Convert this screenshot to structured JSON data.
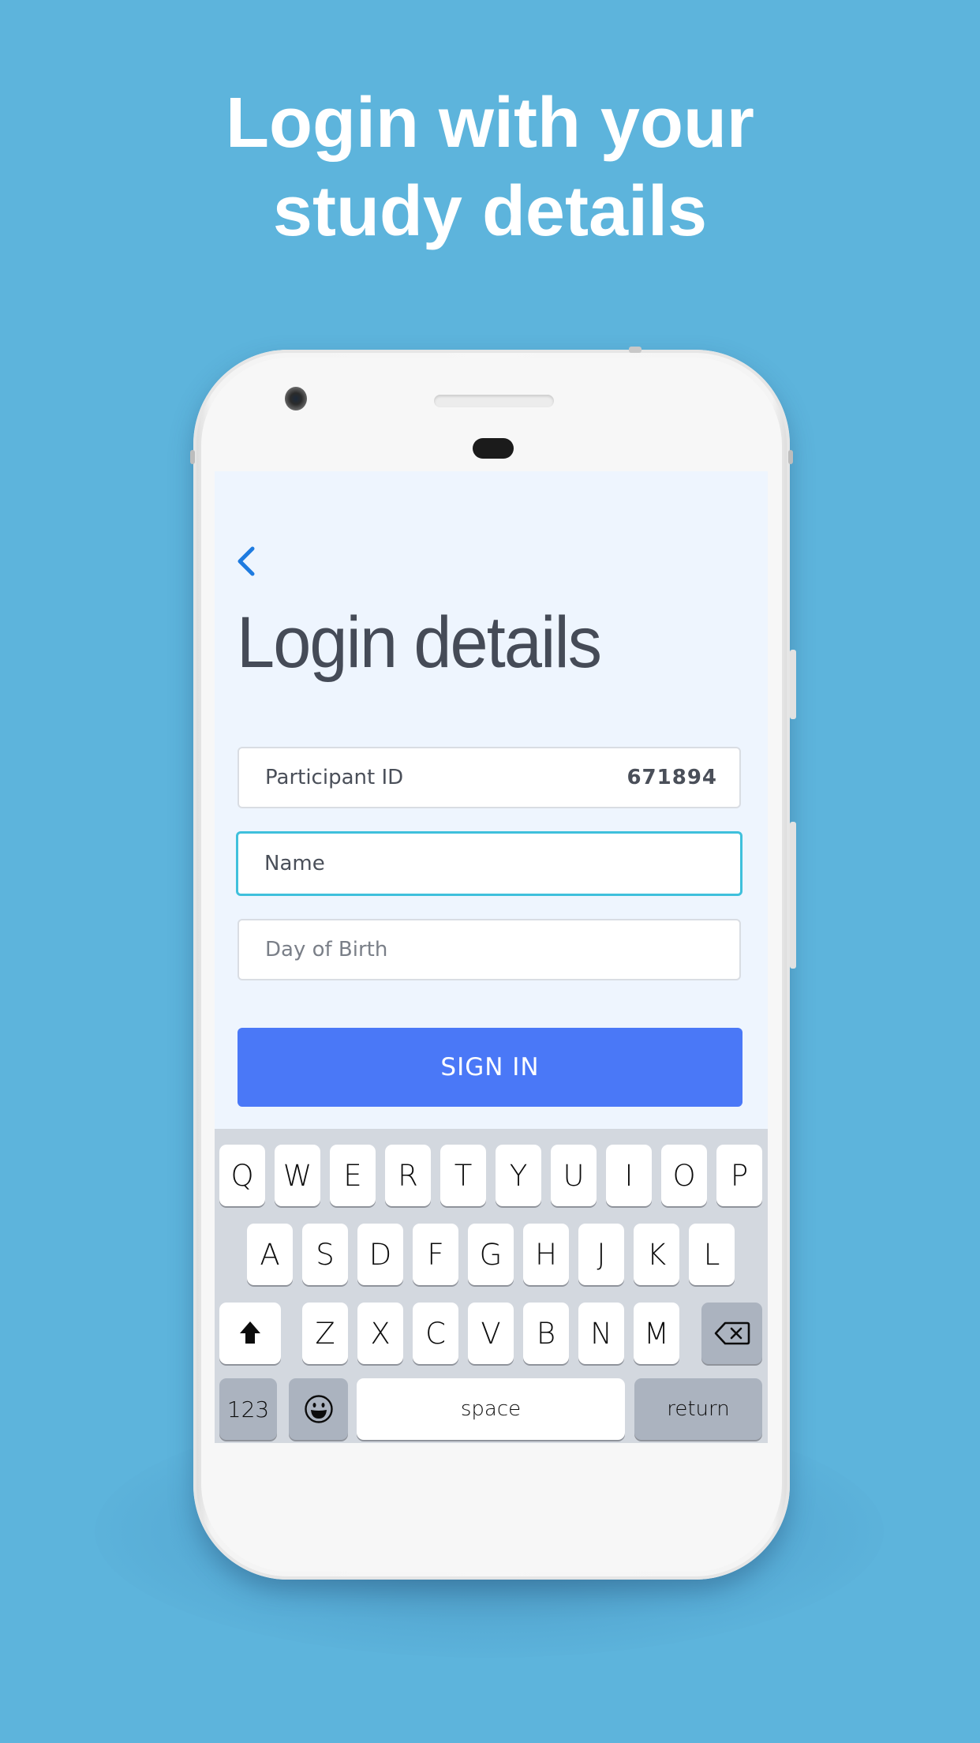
{
  "promo": {
    "headline_line1": "Login with your",
    "headline_line2": "study details",
    "background_color": "#5db4dc"
  },
  "app": {
    "back_icon": "chevron-left-icon",
    "title": "Login details",
    "fields": {
      "participant_id": {
        "label": "Participant ID",
        "value": "671894"
      },
      "name": {
        "placeholder": "Name",
        "value": "",
        "focused": true
      },
      "day_of_birth": {
        "placeholder": "Day of Birth",
        "value": ""
      }
    },
    "signin_label": "SIGN IN",
    "accent_color": "#4a78f7",
    "focus_color": "#3fc0dc"
  },
  "keyboard": {
    "row1": [
      "Q",
      "W",
      "E",
      "R",
      "T",
      "Y",
      "U",
      "I",
      "O",
      "P"
    ],
    "row2": [
      "A",
      "S",
      "D",
      "F",
      "G",
      "H",
      "J",
      "K",
      "L"
    ],
    "row3": [
      "Z",
      "X",
      "C",
      "V",
      "B",
      "N",
      "M"
    ],
    "shift_icon": "shift-icon",
    "delete_icon": "backspace-icon",
    "numbers_label": "123",
    "emoji_icon": "emoji-icon",
    "space_label": "space",
    "return_label": "return"
  }
}
